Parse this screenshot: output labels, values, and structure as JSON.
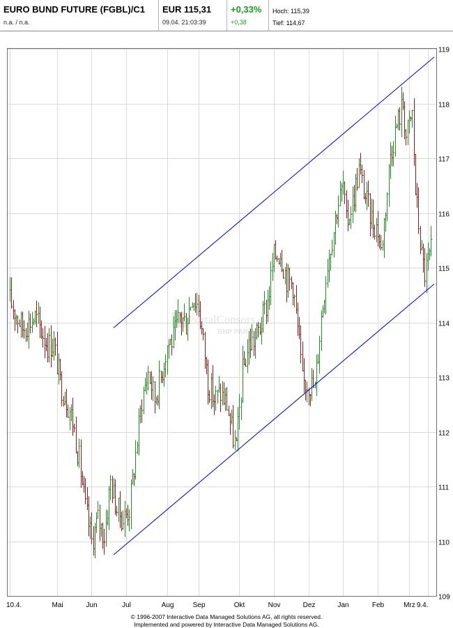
{
  "header": {
    "title": "EURO BUND FUTURE (FGBL)/C1",
    "subline": "n.a.  /  n.a.",
    "price": "EUR 115,31",
    "datetime": "09.04. 21:03:39",
    "change_pct": "+0,33%",
    "change_abs": "+0,38",
    "high": "Hoch: 115,39",
    "low": "Tief: 114,67"
  },
  "watermark": {
    "line1": "PortalConsors",
    "line2": "BNP PARIBAS"
  },
  "footer": {
    "line1": "© 1996-2007 Interactive Data Managed Solutions AG, all rights reserved.",
    "line2": "Implemented and powered by Interactive Data Managed Solutions AG."
  },
  "colors": {
    "up": "#228b22",
    "down": "#8b1a1a",
    "trend": "#0000cc",
    "grid": "#d9d9d9",
    "accent_green": "#1a9a1a"
  },
  "chart_data": {
    "type": "line",
    "subtype": "daily bar chart (high-low) with trend channel",
    "title": "",
    "xlabel": "",
    "ylabel": "",
    "ylim": [
      109,
      119
    ],
    "y_ticks": [
      "109",
      "110",
      "111",
      "112",
      "113",
      "114",
      "115",
      "116",
      "117",
      "118",
      "119"
    ],
    "x_ticks": [
      "10.4.",
      "Mai",
      "Jun",
      "Jul",
      "Aug",
      "Sep",
      "Okt",
      "Nov",
      "Dez",
      "Jan",
      "Feb",
      "Mrz",
      "9.4."
    ],
    "x_tick_index": [
      0,
      15,
      26,
      37,
      50,
      60,
      73,
      84,
      95,
      106,
      117,
      127,
      133
    ],
    "grid": true,
    "x_index_max": 135,
    "anchors": [
      [
        0,
        114.4
      ],
      [
        4,
        113.9
      ],
      [
        8,
        114.1
      ],
      [
        12,
        113.6
      ],
      [
        14,
        113.6
      ],
      [
        16,
        112.9
      ],
      [
        18,
        112.6
      ],
      [
        20,
        112.2
      ],
      [
        22,
        111.5
      ],
      [
        24,
        110.6
      ],
      [
        26,
        110.0
      ],
      [
        28,
        110.4
      ],
      [
        30,
        110.1
      ],
      [
        32,
        111.1
      ],
      [
        34,
        110.6
      ],
      [
        36,
        110.4
      ],
      [
        38,
        110.6
      ],
      [
        40,
        111.6
      ],
      [
        42,
        112.6
      ],
      [
        44,
        113.1
      ],
      [
        46,
        112.6
      ],
      [
        48,
        113.0
      ],
      [
        50,
        113.6
      ],
      [
        52,
        113.7
      ],
      [
        54,
        114.1
      ],
      [
        56,
        114.0
      ],
      [
        58,
        114.5
      ],
      [
        60,
        114.3
      ],
      [
        62,
        113.4
      ],
      [
        63,
        112.9
      ],
      [
        65,
        112.6
      ],
      [
        67,
        112.7
      ],
      [
        69,
        112.5
      ],
      [
        71,
        111.9
      ],
      [
        72,
        111.7
      ],
      [
        74,
        113.1
      ],
      [
        76,
        113.6
      ],
      [
        78,
        113.7
      ],
      [
        80,
        114.0
      ],
      [
        82,
        114.4
      ],
      [
        84,
        115.2
      ],
      [
        86,
        115.3
      ],
      [
        88,
        114.8
      ],
      [
        90,
        114.7
      ],
      [
        92,
        113.6
      ],
      [
        93,
        112.9
      ],
      [
        95,
        112.9
      ],
      [
        97,
        112.8
      ],
      [
        99,
        114.1
      ],
      [
        101,
        115.1
      ],
      [
        103,
        115.7
      ],
      [
        104,
        116.1
      ],
      [
        106,
        116.5
      ],
      [
        107,
        115.8
      ],
      [
        109,
        116.2
      ],
      [
        111,
        116.8
      ],
      [
        113,
        116.3
      ],
      [
        115,
        115.9
      ],
      [
        117,
        115.7
      ],
      [
        118,
        115.3
      ],
      [
        120,
        116.4
      ],
      [
        121,
        117.1
      ],
      [
        123,
        117.6
      ],
      [
        125,
        118.0
      ],
      [
        126,
        117.4
      ],
      [
        128,
        117.8
      ],
      [
        129,
        116.4
      ],
      [
        130,
        115.8
      ],
      [
        131,
        115.2
      ],
      [
        132,
        114.9
      ],
      [
        133,
        115.1
      ],
      [
        134,
        115.3
      ]
    ],
    "trend_lines": [
      {
        "name": "upper channel",
        "from": [
          33,
          113.9
        ],
        "to": [
          135,
          118.85
        ]
      },
      {
        "name": "lower channel",
        "from": [
          33,
          109.75
        ],
        "to": [
          135,
          114.7
        ]
      }
    ]
  }
}
